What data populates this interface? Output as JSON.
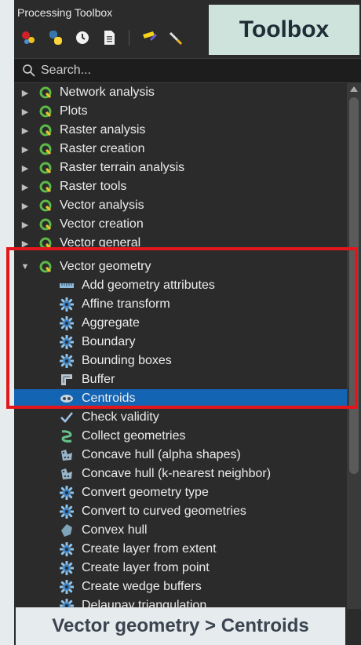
{
  "panel": {
    "title": "Processing Toolbox"
  },
  "badge": {
    "text": "Toolbox"
  },
  "toolbar": {
    "icons": [
      "models-icon",
      "python-icon",
      "history-icon",
      "results-icon",
      "edit-features-icon",
      "options-icon"
    ]
  },
  "search": {
    "placeholder": "Search..."
  },
  "tree": {
    "groups": [
      {
        "label": "Network analysis",
        "expanded": false
      },
      {
        "label": "Plots",
        "expanded": false
      },
      {
        "label": "Raster analysis",
        "expanded": false
      },
      {
        "label": "Raster creation",
        "expanded": false
      },
      {
        "label": "Raster terrain analysis",
        "expanded": false
      },
      {
        "label": "Raster tools",
        "expanded": false
      },
      {
        "label": "Vector analysis",
        "expanded": false
      },
      {
        "label": "Vector creation",
        "expanded": false
      },
      {
        "label": "Vector general",
        "expanded": false
      },
      {
        "label": "Vector geometry",
        "expanded": true
      }
    ],
    "algorithms": [
      {
        "label": "Add geometry attributes",
        "icon": "ruler-icon"
      },
      {
        "label": "Affine transform",
        "icon": "gear-icon"
      },
      {
        "label": "Aggregate",
        "icon": "gear-icon"
      },
      {
        "label": "Boundary",
        "icon": "gear-icon"
      },
      {
        "label": "Bounding boxes",
        "icon": "gear-icon"
      },
      {
        "label": "Buffer",
        "icon": "buffer-icon"
      },
      {
        "label": "Centroids",
        "icon": "centroids-icon",
        "selected": true
      },
      {
        "label": "Check validity",
        "icon": "checkmark-icon"
      },
      {
        "label": "Collect geometries",
        "icon": "collect-icon"
      },
      {
        "label": "Concave hull (alpha shapes)",
        "icon": "concave-hull-icon"
      },
      {
        "label": "Concave hull (k-nearest neighbor)",
        "icon": "concave-hull-icon"
      },
      {
        "label": "Convert geometry type",
        "icon": "gear-icon"
      },
      {
        "label": "Convert to curved geometries",
        "icon": "gear-icon"
      },
      {
        "label": "Convex hull",
        "icon": "convex-hull-icon"
      },
      {
        "label": "Create layer from extent",
        "icon": "gear-icon"
      },
      {
        "label": "Create layer from point",
        "icon": "gear-icon"
      },
      {
        "label": "Create wedge buffers",
        "icon": "gear-icon"
      },
      {
        "label": "Delaunay triangulation",
        "icon": "gear-icon"
      }
    ]
  },
  "caption": {
    "text": "Vector geometry > Centroids"
  },
  "colors": {
    "selection": "#1464b4",
    "highlight_box": "#e3161b",
    "qgis_green": "#5cb847"
  }
}
